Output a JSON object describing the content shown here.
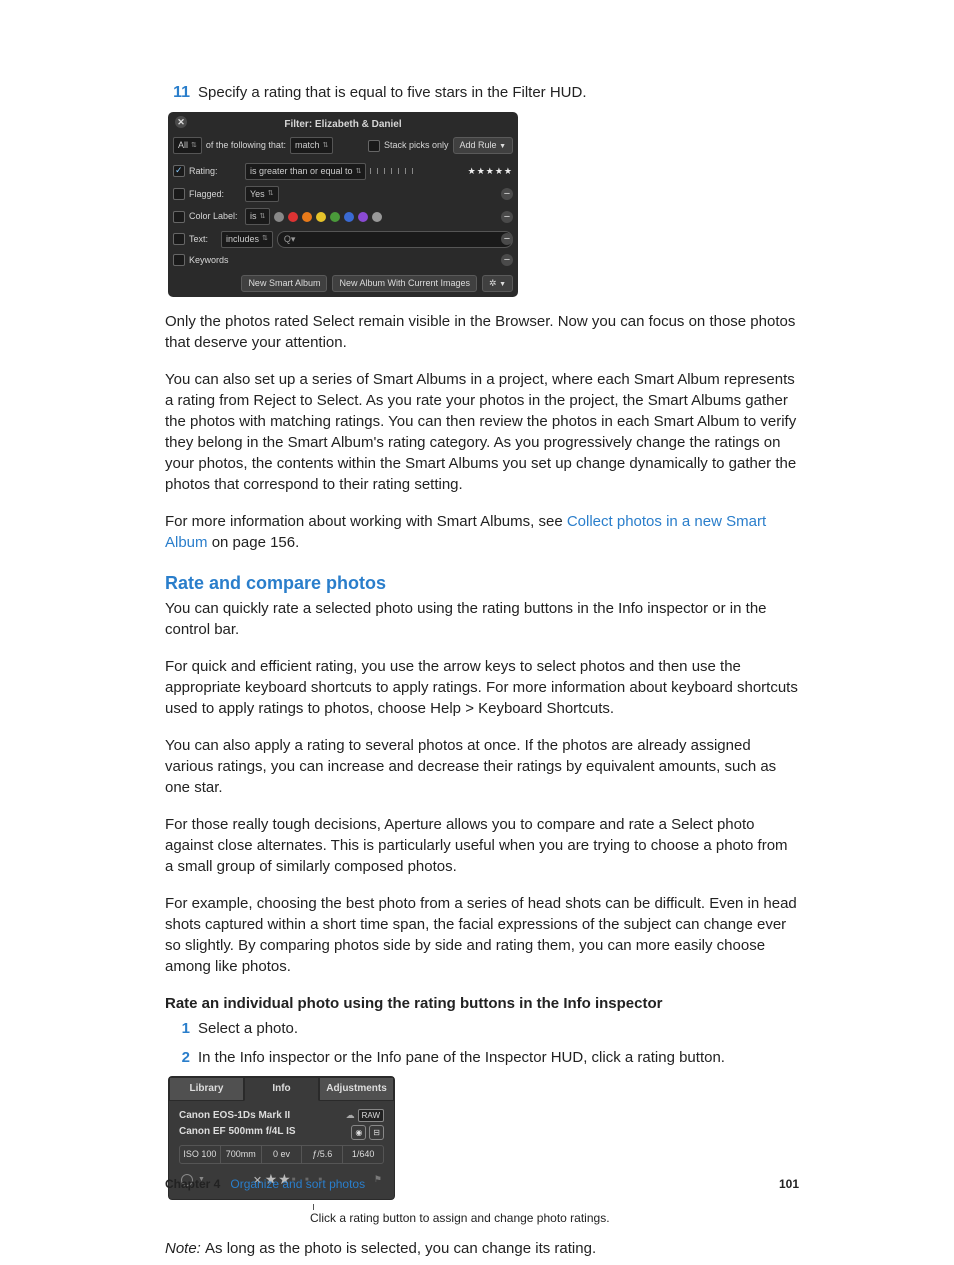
{
  "step11": {
    "num": "11",
    "text": "Specify a rating that is equal to five stars in the Filter HUD."
  },
  "hud": {
    "title": "Filter: Elizabeth & Daniel",
    "toprow": {
      "all": "All",
      "of": "of the following that:",
      "match": "match",
      "stackpicks": "Stack picks only",
      "addRule": "Add Rule"
    },
    "rating": {
      "label": "Rating:",
      "op": "is greater than or equal to",
      "stars": "★★★★★"
    },
    "flagged": {
      "label": "Flagged:",
      "val": "Yes"
    },
    "colorlabel": {
      "label": "Color Label:",
      "op": "is"
    },
    "text": {
      "label": "Text:",
      "op": "includes",
      "searchIcon": "Q▾"
    },
    "keywords": {
      "label": "Keywords"
    },
    "btn1": "New Smart Album",
    "btn2": "New Album With Current Images"
  },
  "para1": "Only the photos rated Select remain visible in the Browser. Now you can focus on those photos that deserve your attention.",
  "para2": "You can also set up a series of Smart Albums in a project, where each Smart Album represents a rating from Reject to Select. As you rate your photos in the project, the Smart Albums gather the photos with matching ratings. You can then review the photos in each Smart Album to verify they belong in the Smart Album's rating category. As you progressively change the ratings on your photos, the contents within the Smart Albums you set up change dynamically to gather the photos that correspond to their rating setting.",
  "para3a": "For more information about working with Smart Albums, see ",
  "para3link": "Collect photos in a new Smart Album",
  "para3b": " on page 156.",
  "h2": "Rate and compare photos",
  "para4": "You can quickly rate a selected photo using the rating buttons in the Info inspector or in the control bar.",
  "para5": "For quick and efficient rating, you use the arrow keys to select photos and then use the appropriate keyboard shortcuts to apply ratings. For more information about keyboard shortcuts used to apply ratings to photos, choose Help > Keyboard Shortcuts.",
  "para6": "You can also apply a rating to several photos at once. If the photos are already assigned various ratings, you can increase and decrease their ratings by equivalent amounts, such as one star.",
  "para7": "For those really tough decisions, Aperture allows you to compare and rate a Select photo against close alternates. This is particularly useful when you are trying to choose a photo from a small group of similarly composed photos.",
  "para8": "For example, choosing the best photo from a series of head shots can be difficult. Even in head shots captured within a short time span, the facial expressions of the subject can change ever so slightly. By comparing photos side by side and rating them, you can more easily choose among like photos.",
  "subhead": "Rate an individual photo using the rating buttons in the Info inspector",
  "s1": {
    "num": "1",
    "text": "Select a photo."
  },
  "s2": {
    "num": "2",
    "text": "In the Info inspector or the Info pane of the Inspector HUD, click a rating button."
  },
  "inspector": {
    "tabs": {
      "library": "Library",
      "info": "Info",
      "adjustments": "Adjustments"
    },
    "camera": "Canon EOS-1Ds Mark II",
    "lens": "Canon EF 500mm f/4L IS",
    "raw": "RAW",
    "meta": {
      "iso": "ISO 100",
      "fl": "700mm",
      "ev": "0 ev",
      "ap": "ƒ/5.6",
      "ss": "1/640"
    }
  },
  "callout": "Click a rating button to assign and change photo ratings.",
  "noteLabel": "Note:  ",
  "noteText": "As long as the photo is selected, you can change its rating.",
  "footer": {
    "chapter": "Chapter 4",
    "title": "Organize and sort photos",
    "page": "101"
  }
}
